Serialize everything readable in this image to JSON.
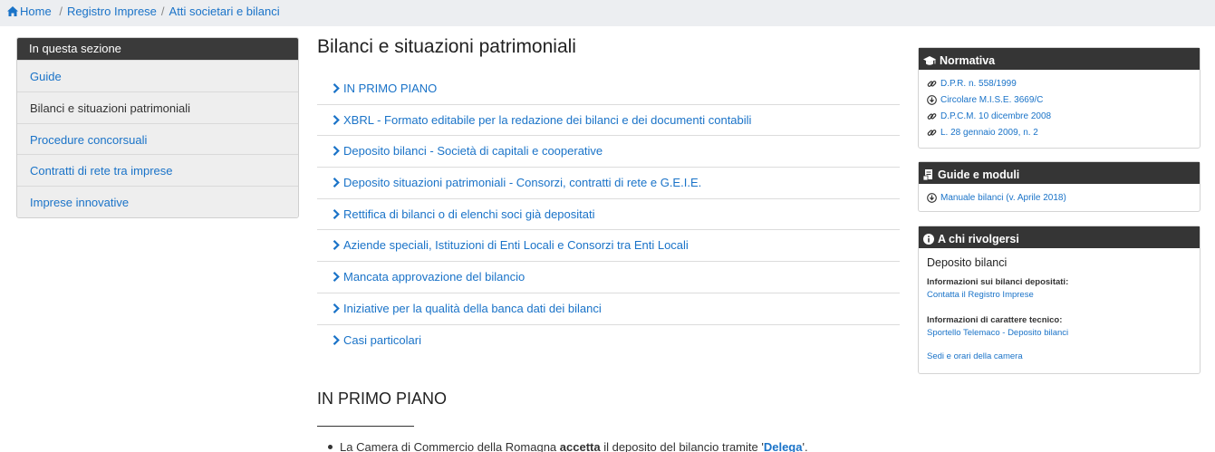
{
  "breadcrumb": {
    "home": "Home",
    "items": [
      "Registro Imprese",
      "Atti societari e bilanci"
    ],
    "separator": "/"
  },
  "sidebar": {
    "title": "In questa sezione",
    "items": [
      {
        "label": "Guide",
        "active": false
      },
      {
        "label": "Bilanci e situazioni patrimoniali",
        "active": true
      },
      {
        "label": "Procedure concorsuali",
        "active": false
      },
      {
        "label": "Contratti di rete tra imprese",
        "active": false
      },
      {
        "label": "Imprese innovative",
        "active": false
      }
    ]
  },
  "main": {
    "title": "Bilanci e situazioni patrimoniali",
    "links": [
      "IN PRIMO PIANO",
      "XBRL - Formato editabile per la redazione dei bilanci e dei documenti contabili",
      "Deposito bilanci - Società di capitali e cooperative",
      "Deposito situazioni patrimoniali - Consorzi, contratti di rete e G.E.I.E.",
      "Rettifica di bilanci o di elenchi soci già depositati",
      "Aziende speciali, Istituzioni di Enti Locali e Consorzi tra Enti Locali",
      "Mancata approvazione del bilancio",
      "Iniziative per la qualità della banca dati dei bilanci",
      "Casi particolari"
    ],
    "section_title": "IN PRIMO PIANO",
    "bullet": {
      "prefix": "La Camera di Commercio della Romagna ",
      "bold": "accetta",
      "middle": " il deposito del bilancio tramite '",
      "link": "Delega",
      "suffix": "'."
    }
  },
  "normativa": {
    "title": "Normativa",
    "items": [
      {
        "label": "D.P.R. n. 558/1999",
        "icon": "link-icon"
      },
      {
        "label": "Circolare M.I.S.E. 3669/C",
        "icon": "download-icon"
      },
      {
        "label": "D.P.C.M. 10 dicembre 2008",
        "icon": "link-icon"
      },
      {
        "label": "L. 28 gennaio 2009, n. 2",
        "icon": "link-icon"
      }
    ]
  },
  "guide": {
    "title": "Guide e moduli",
    "items": [
      {
        "label": "Manuale bilanci (v. Aprile 2018)",
        "icon": "download-icon"
      }
    ]
  },
  "contacts": {
    "title": "A chi rivolgersi",
    "subtitle": "Deposito bilanci",
    "label1": "Informazioni sui bilanci depositati:",
    "link1": "Contatta il Registro Imprese",
    "label2": "Informazioni di carattere tecnico:",
    "link2": "Sportello Telemaco - Deposito bilanci",
    "link3": "Sedi e orari della camera"
  },
  "colors": {
    "link": "#1a73c8",
    "header_bg": "#353535",
    "breadcrumb_bg": "#eceef1"
  }
}
